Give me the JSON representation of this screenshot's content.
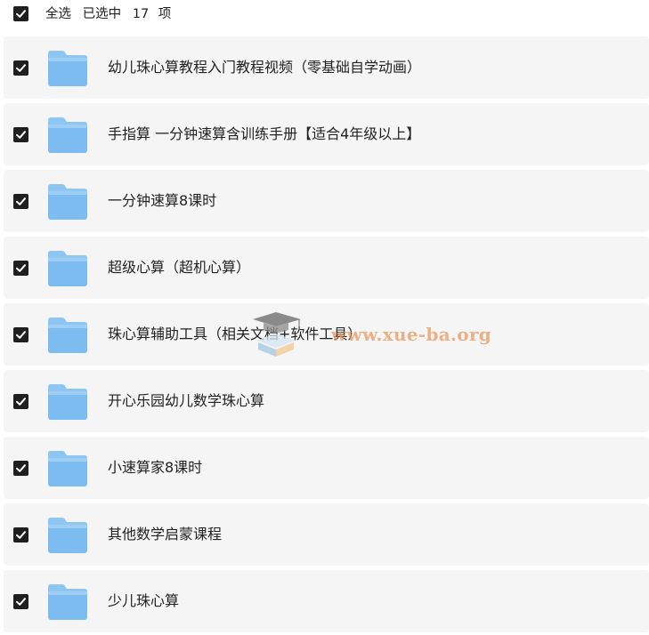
{
  "header": {
    "select_all_label": "全选",
    "selected_prefix": "已选中",
    "selected_count": "17",
    "selected_suffix": "项",
    "select_all_checked": true
  },
  "items": [
    {
      "name": "幼儿珠心算教程入门教程视频（零基础自学动画）",
      "checked": true,
      "icon": "folder-icon"
    },
    {
      "name": "手指算 一分钟速算含训练手册【适合4年级以上】",
      "checked": true,
      "icon": "folder-icon"
    },
    {
      "name": "一分钟速算8课时",
      "checked": true,
      "icon": "folder-icon"
    },
    {
      "name": "超级心算（超机心算）",
      "checked": true,
      "icon": "folder-icon"
    },
    {
      "name": "珠心算辅助工具（相关文档+软件工具）",
      "checked": true,
      "icon": "folder-icon"
    },
    {
      "name": "开心乐园幼儿数学珠心算",
      "checked": true,
      "icon": "folder-icon"
    },
    {
      "name": "小速算家8课时",
      "checked": true,
      "icon": "folder-icon"
    },
    {
      "name": "其他数学启蒙课程",
      "checked": true,
      "icon": "folder-icon"
    },
    {
      "name": "少儿珠心算",
      "checked": true,
      "icon": "folder-icon"
    }
  ],
  "watermark": {
    "text": "www.xue-ba.org",
    "icon": "graduation-cap-book-icon"
  },
  "colors": {
    "row_background": "#f5f5f5",
    "checkbox_fill": "#1f1f1f",
    "folder_blue": "#7dbcf0",
    "folder_tab_blue": "#8ec6f2",
    "text": "#222222",
    "watermark": "#e8965a"
  }
}
